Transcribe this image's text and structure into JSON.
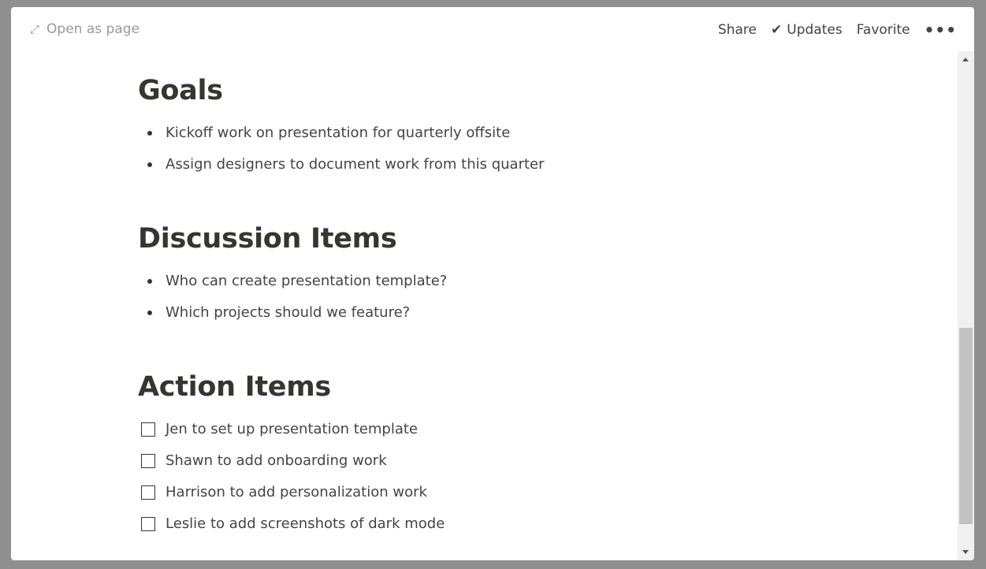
{
  "topbar": {
    "open_as_page": "Open as page",
    "share": "Share",
    "updates": "Updates",
    "favorite": "Favorite",
    "more": "•••"
  },
  "sections": [
    {
      "title": "Goals",
      "items": [
        "Kickoff work on presentation for quarterly offsite",
        "Assign designers to document work from this quarter"
      ]
    },
    {
      "title": "Discussion Items",
      "items": [
        "Who can create presentation template?",
        "Which projects should we feature?"
      ]
    },
    {
      "title": "Action Items",
      "items": [
        "Jen to set up presentation template",
        "Shawn to add onboarding work",
        "Harrison to add personalization work",
        "Leslie to add screenshots of dark mode"
      ]
    }
  ],
  "scroll": {
    "position_percent": 62
  }
}
